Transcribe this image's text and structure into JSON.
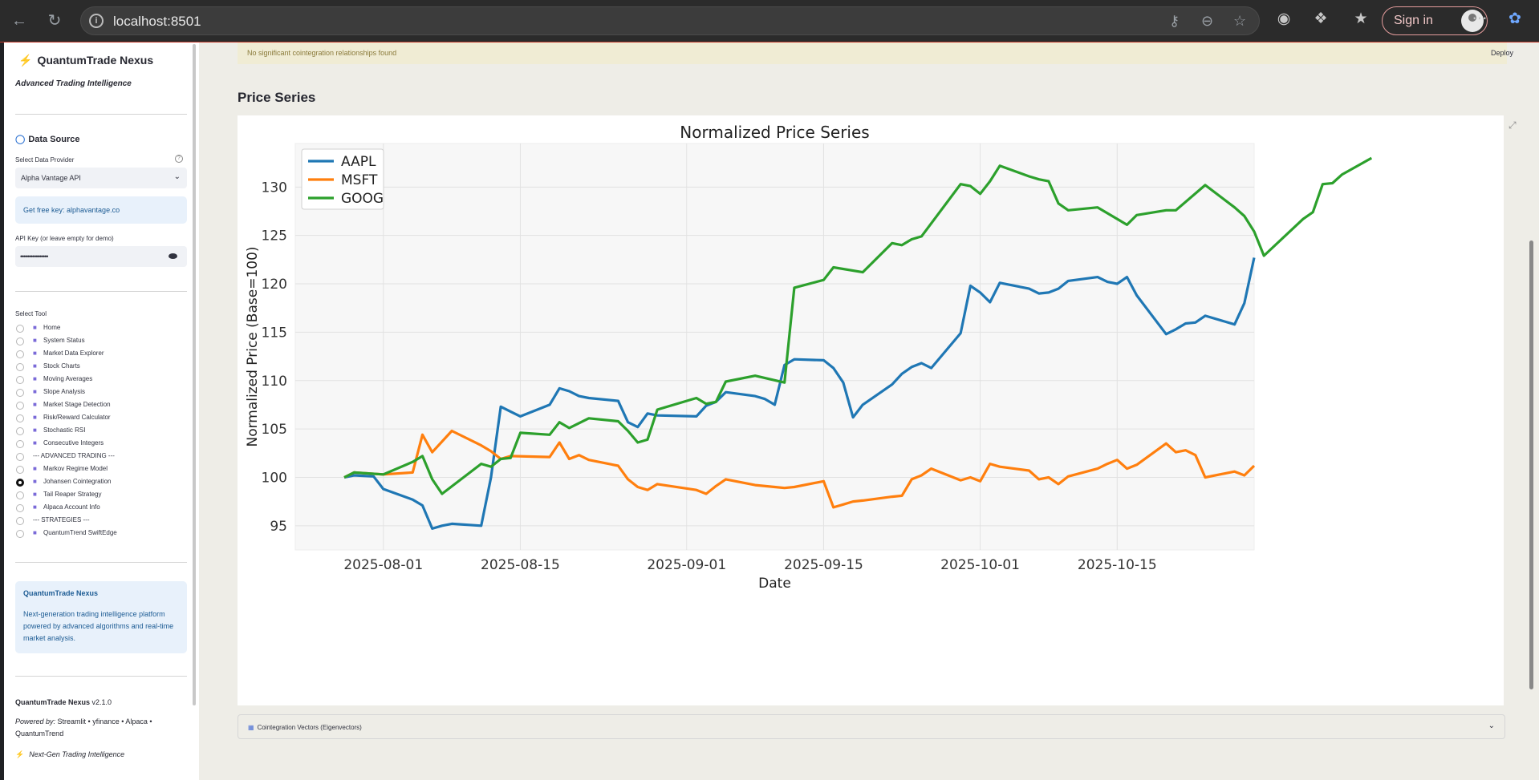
{
  "browser": {
    "url": "localhost:8501",
    "signin_label": "Sign in"
  },
  "sidebar": {
    "app_title": "QuantumTrade Nexus",
    "tagline": "Advanced Trading Intelligence",
    "data_source_header": "Data Source",
    "provider_label": "Select Data Provider",
    "provider_value": "Alpha Vantage API",
    "info_text": "Get free key: alphavantage.co",
    "api_key_label": "API Key (or leave empty for demo)",
    "api_key_value": "••••••••••••••••",
    "tool_label": "Select Tool",
    "tools": [
      {
        "label": "Home",
        "selected": false
      },
      {
        "label": "System Status",
        "selected": false
      },
      {
        "label": "Market Data Explorer",
        "selected": false
      },
      {
        "label": "Stock Charts",
        "selected": false
      },
      {
        "label": "Moving Averages",
        "selected": false
      },
      {
        "label": "Slope Analysis",
        "selected": false
      },
      {
        "label": "Market Stage Detection",
        "selected": false
      },
      {
        "label": "Risk/Reward Calculator",
        "selected": false
      },
      {
        "label": "Stochastic RSI",
        "selected": false
      },
      {
        "label": "Consecutive Integers",
        "selected": false
      },
      {
        "label": "--- ADVANCED TRADING ---",
        "selected": false
      },
      {
        "label": "Markov Regime Model",
        "selected": false
      },
      {
        "label": "Johansen Cointegration",
        "selected": true
      },
      {
        "label": "Tail Reaper Strategy",
        "selected": false
      },
      {
        "label": "Alpaca Account Info",
        "selected": false
      },
      {
        "label": "--- STRATEGIES ---",
        "selected": false
      },
      {
        "label": "QuantumTrend SwiftEdge",
        "selected": false
      }
    ],
    "about_title": "QuantumTrade Nexus",
    "about_text": "Next-generation trading intelligence platform powered by advanced algorithms and real-time market analysis.",
    "version_name": "QuantumTrade Nexus",
    "version": "v2.1.0",
    "powered_prefix": "Powered by:",
    "powered_text": "Streamlit • yfinance • Alpaca • QuantumTrend",
    "footer_tag": "Next-Gen Trading Intelligence"
  },
  "main": {
    "warning": "No significant cointegration relationships found",
    "deploy": "Deploy",
    "section_title": "Price Series",
    "expander_label": "Cointegration Vectors (Eigenvectors)"
  },
  "chart_data": {
    "type": "line",
    "title": "Normalized Price Series",
    "xlabel": "Date",
    "ylabel": "Normalized Price (Base=100)",
    "x_ticks": [
      "2025-08-01",
      "2025-08-15",
      "2025-09-01",
      "2025-09-15",
      "2025-10-01",
      "2025-10-15"
    ],
    "y_ticks": [
      95,
      100,
      105,
      110,
      115,
      120,
      125,
      130
    ],
    "ylim": [
      92.5,
      134.5
    ],
    "xlim": [
      "2025-07-23",
      "2025-10-29"
    ],
    "grid": true,
    "legend_position": "top-left",
    "series": [
      {
        "name": "AAPL",
        "color": "#1f77b4",
        "points": [
          [
            "2025-07-28",
            100.0
          ],
          [
            "2025-07-29",
            100.2
          ],
          [
            "2025-07-31",
            100.1
          ],
          [
            "2025-08-01",
            98.8
          ],
          [
            "2025-08-04",
            97.7
          ],
          [
            "2025-08-05",
            97.1
          ],
          [
            "2025-08-06",
            94.7
          ],
          [
            "2025-08-07",
            95.0
          ],
          [
            "2025-08-08",
            95.2
          ],
          [
            "2025-08-11",
            95.0
          ],
          [
            "2025-08-12",
            100.0
          ],
          [
            "2025-08-13",
            107.3
          ],
          [
            "2025-08-14",
            106.8
          ],
          [
            "2025-08-15",
            106.3
          ],
          [
            "2025-08-18",
            107.5
          ],
          [
            "2025-08-19",
            109.2
          ],
          [
            "2025-08-20",
            108.9
          ],
          [
            "2025-08-21",
            108.4
          ],
          [
            "2025-08-22",
            108.2
          ],
          [
            "2025-08-25",
            107.9
          ],
          [
            "2025-08-26",
            105.7
          ],
          [
            "2025-08-27",
            105.2
          ],
          [
            "2025-08-28",
            106.6
          ],
          [
            "2025-08-29",
            106.4
          ],
          [
            "2025-09-02",
            106.3
          ],
          [
            "2025-09-03",
            107.4
          ],
          [
            "2025-09-04",
            107.8
          ],
          [
            "2025-09-05",
            108.8
          ],
          [
            "2025-09-08",
            108.4
          ],
          [
            "2025-09-09",
            108.1
          ],
          [
            "2025-09-10",
            107.5
          ],
          [
            "2025-09-11",
            111.6
          ],
          [
            "2025-09-12",
            112.2
          ],
          [
            "2025-09-15",
            112.1
          ],
          [
            "2025-09-16",
            111.3
          ],
          [
            "2025-09-17",
            109.8
          ],
          [
            "2025-09-18",
            106.2
          ],
          [
            "2025-09-19",
            107.5
          ],
          [
            "2025-09-22",
            109.6
          ],
          [
            "2025-09-23",
            110.7
          ],
          [
            "2025-09-24",
            111.4
          ],
          [
            "2025-09-25",
            111.8
          ],
          [
            "2025-09-26",
            111.3
          ],
          [
            "2025-09-29",
            114.9
          ],
          [
            "2025-09-30",
            119.8
          ],
          [
            "2025-10-01",
            119.1
          ],
          [
            "2025-10-02",
            118.1
          ],
          [
            "2025-10-03",
            120.1
          ],
          [
            "2025-10-06",
            119.5
          ],
          [
            "2025-10-07",
            119.0
          ],
          [
            "2025-10-08",
            119.1
          ],
          [
            "2025-10-09",
            119.5
          ],
          [
            "2025-10-10",
            120.3
          ],
          [
            "2025-10-13",
            120.7
          ],
          [
            "2025-10-14",
            120.2
          ],
          [
            "2025-10-15",
            120.0
          ],
          [
            "2025-10-16",
            120.7
          ],
          [
            "2025-10-17",
            118.8
          ],
          [
            "2025-10-20",
            114.8
          ],
          [
            "2025-10-21",
            115.3
          ],
          [
            "2025-10-22",
            115.9
          ],
          [
            "2025-10-23",
            116.0
          ],
          [
            "2025-10-24",
            116.7
          ],
          [
            "2025-10-27",
            115.8
          ],
          [
            "2025-10-28",
            118.0
          ],
          [
            "2025-10-29",
            122.7
          ]
        ]
      },
      {
        "name": "MSFT",
        "color": "#ff7f0e",
        "points": [
          [
            "2025-07-28",
            100.0
          ],
          [
            "2025-07-29",
            100.5
          ],
          [
            "2025-08-01",
            100.3
          ],
          [
            "2025-08-04",
            100.5
          ],
          [
            "2025-08-05",
            104.4
          ],
          [
            "2025-08-06",
            102.6
          ],
          [
            "2025-08-08",
            104.8
          ],
          [
            "2025-08-11",
            103.3
          ],
          [
            "2025-08-12",
            102.7
          ],
          [
            "2025-08-13",
            101.9
          ],
          [
            "2025-08-14",
            102.2
          ],
          [
            "2025-08-18",
            102.1
          ],
          [
            "2025-08-19",
            103.6
          ],
          [
            "2025-08-20",
            101.9
          ],
          [
            "2025-08-21",
            102.3
          ],
          [
            "2025-08-22",
            101.8
          ],
          [
            "2025-08-25",
            101.2
          ],
          [
            "2025-08-26",
            99.8
          ],
          [
            "2025-08-27",
            99.0
          ],
          [
            "2025-08-28",
            98.7
          ],
          [
            "2025-08-29",
            99.3
          ],
          [
            "2025-09-02",
            98.7
          ],
          [
            "2025-09-03",
            98.3
          ],
          [
            "2025-09-04",
            99.1
          ],
          [
            "2025-09-05",
            99.8
          ],
          [
            "2025-09-08",
            99.2
          ],
          [
            "2025-09-10",
            99.0
          ],
          [
            "2025-09-11",
            98.9
          ],
          [
            "2025-09-12",
            99.0
          ],
          [
            "2025-09-15",
            99.6
          ],
          [
            "2025-09-16",
            96.9
          ],
          [
            "2025-09-17",
            97.2
          ],
          [
            "2025-09-18",
            97.5
          ],
          [
            "2025-09-19",
            97.6
          ],
          [
            "2025-09-22",
            98.0
          ],
          [
            "2025-09-23",
            98.1
          ],
          [
            "2025-09-24",
            99.8
          ],
          [
            "2025-09-25",
            100.2
          ],
          [
            "2025-09-26",
            100.9
          ],
          [
            "2025-09-29",
            99.7
          ],
          [
            "2025-09-30",
            100.0
          ],
          [
            "2025-10-01",
            99.6
          ],
          [
            "2025-10-02",
            101.4
          ],
          [
            "2025-10-03",
            101.1
          ],
          [
            "2025-10-06",
            100.7
          ],
          [
            "2025-10-07",
            99.8
          ],
          [
            "2025-10-08",
            100.0
          ],
          [
            "2025-10-09",
            99.3
          ],
          [
            "2025-10-10",
            100.1
          ],
          [
            "2025-10-13",
            100.9
          ],
          [
            "2025-10-14",
            101.4
          ],
          [
            "2025-10-15",
            101.8
          ],
          [
            "2025-10-16",
            100.9
          ],
          [
            "2025-10-17",
            101.3
          ],
          [
            "2025-10-20",
            103.5
          ],
          [
            "2025-10-21",
            102.6
          ],
          [
            "2025-10-22",
            102.8
          ],
          [
            "2025-10-23",
            102.3
          ],
          [
            "2025-10-24",
            100.0
          ],
          [
            "2025-10-27",
            100.6
          ],
          [
            "2025-10-28",
            100.2
          ],
          [
            "2025-10-29",
            101.2
          ]
        ]
      },
      {
        "name": "GOOG",
        "color": "#2ca02c",
        "points": [
          [
            "2025-07-28",
            100.0
          ],
          [
            "2025-07-29",
            100.5
          ],
          [
            "2025-08-01",
            100.3
          ],
          [
            "2025-08-04",
            101.6
          ],
          [
            "2025-08-05",
            102.2
          ],
          [
            "2025-08-06",
            99.8
          ],
          [
            "2025-08-07",
            98.3
          ],
          [
            "2025-08-11",
            101.4
          ],
          [
            "2025-08-12",
            101.1
          ],
          [
            "2025-08-13",
            101.9
          ],
          [
            "2025-08-14",
            102.0
          ],
          [
            "2025-08-15",
            104.6
          ],
          [
            "2025-08-18",
            104.4
          ],
          [
            "2025-08-19",
            105.7
          ],
          [
            "2025-08-20",
            105.1
          ],
          [
            "2025-08-22",
            106.1
          ],
          [
            "2025-08-25",
            105.8
          ],
          [
            "2025-08-26",
            104.8
          ],
          [
            "2025-08-27",
            103.6
          ],
          [
            "2025-08-28",
            103.9
          ],
          [
            "2025-08-29",
            107.0
          ],
          [
            "2025-09-02",
            108.2
          ],
          [
            "2025-09-03",
            107.6
          ],
          [
            "2025-09-04",
            107.8
          ],
          [
            "2025-09-05",
            109.9
          ],
          [
            "2025-09-08",
            110.5
          ],
          [
            "2025-09-11",
            109.8
          ],
          [
            "2025-09-12",
            119.6
          ],
          [
            "2025-09-15",
            120.4
          ],
          [
            "2025-09-16",
            121.7
          ],
          [
            "2025-09-19",
            121.2
          ],
          [
            "2025-09-22",
            124.2
          ],
          [
            "2025-09-23",
            124.0
          ],
          [
            "2025-09-24",
            124.6
          ],
          [
            "2025-09-25",
            124.9
          ],
          [
            "2025-09-29",
            130.3
          ],
          [
            "2025-09-30",
            130.1
          ],
          [
            "2025-10-01",
            129.3
          ],
          [
            "2025-10-02",
            130.6
          ],
          [
            "2025-10-03",
            132.2
          ],
          [
            "2025-10-06",
            131.1
          ],
          [
            "2025-10-07",
            130.8
          ],
          [
            "2025-10-08",
            130.6
          ],
          [
            "2025-10-09",
            128.3
          ],
          [
            "2025-10-10",
            127.6
          ],
          [
            "2025-10-13",
            127.9
          ],
          [
            "2025-10-16",
            126.1
          ],
          [
            "2025-10-17",
            127.1
          ],
          [
            "2025-10-20",
            127.6
          ],
          [
            "2025-10-21",
            127.6
          ],
          [
            "2025-10-24",
            130.2
          ],
          [
            "2025-10-27",
            127.9
          ],
          [
            "2025-10-28",
            127.0
          ],
          [
            "2025-10-29",
            125.4
          ],
          [
            "2025-10-30",
            122.9
          ],
          [
            "2025-11-03",
            126.7
          ],
          [
            "2025-11-04",
            127.4
          ],
          [
            "2025-11-05",
            130.3
          ],
          [
            "2025-11-06",
            130.4
          ],
          [
            "2025-11-07",
            131.3
          ],
          [
            "2025-11-10",
            133.0
          ]
        ]
      }
    ]
  }
}
